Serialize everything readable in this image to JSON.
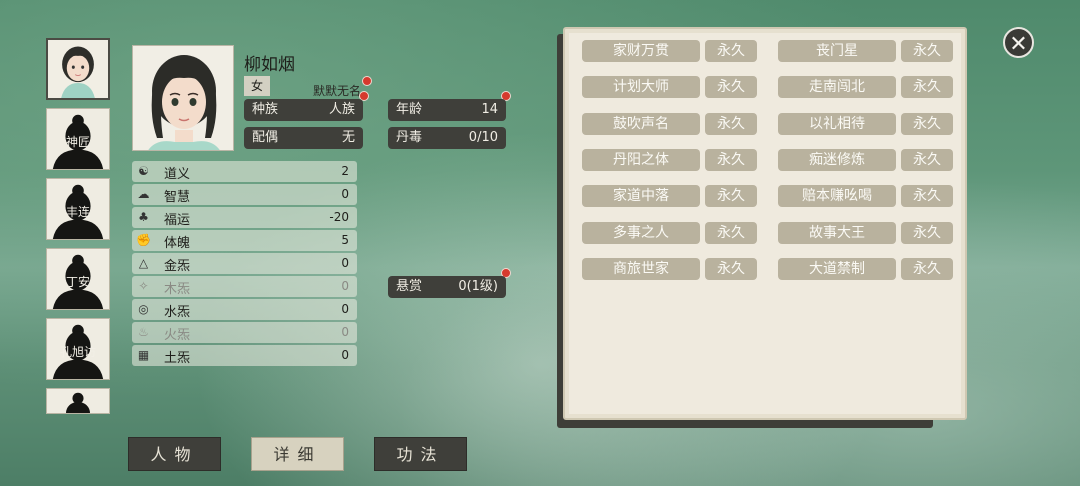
{
  "character": {
    "name": "柳如烟",
    "gender": "女",
    "title": "默默无名",
    "race_label": "种族",
    "race": "人族",
    "spouse_label": "配偶",
    "spouse": "无",
    "age_label": "年龄",
    "age": "14",
    "poison_label": "丹毒",
    "poison": "0/10",
    "bounty_label": "悬赏",
    "bounty": "0(1级)"
  },
  "sidebar": {
    "characters": [
      {
        "name": ""
      },
      {
        "name": "神匠"
      },
      {
        "name": "丰连"
      },
      {
        "name": "丁安"
      },
      {
        "name": "孔旭访"
      },
      {
        "name": ""
      }
    ]
  },
  "stats": [
    {
      "icon": "yin-yang-icon",
      "label": "道义",
      "value": "2",
      "dim": false
    },
    {
      "icon": "brain-icon",
      "label": "智慧",
      "value": "0",
      "dim": false
    },
    {
      "icon": "clover-icon",
      "label": "福运",
      "value": "-20",
      "dim": false
    },
    {
      "icon": "fist-icon",
      "label": "体魄",
      "value": "5",
      "dim": false
    },
    {
      "icon": "metal-icon",
      "label": "金炁",
      "value": "0",
      "dim": false
    },
    {
      "icon": "wood-icon",
      "label": "木炁",
      "value": "0",
      "dim": true
    },
    {
      "icon": "water-icon",
      "label": "水炁",
      "value": "0",
      "dim": false
    },
    {
      "icon": "fire-icon",
      "label": "火炁",
      "value": "0",
      "dim": true
    },
    {
      "icon": "earth-icon",
      "label": "土炁",
      "value": "0",
      "dim": false
    }
  ],
  "traits": [
    {
      "name": "家财万贯",
      "duration": "永久"
    },
    {
      "name": "丧门星",
      "duration": "永久"
    },
    {
      "name": "计划大师",
      "duration": "永久"
    },
    {
      "name": "走南闯北",
      "duration": "永久"
    },
    {
      "name": "鼓吹声名",
      "duration": "永久"
    },
    {
      "name": "以礼相待",
      "duration": "永久"
    },
    {
      "name": "丹阳之体",
      "duration": "永久"
    },
    {
      "name": "痴迷修炼",
      "duration": "永久"
    },
    {
      "name": "家道中落",
      "duration": "永久"
    },
    {
      "name": "赔本赚吆喝",
      "duration": "永久"
    },
    {
      "name": "多事之人",
      "duration": "永久"
    },
    {
      "name": "故事大王",
      "duration": "永久"
    },
    {
      "name": "商旅世家",
      "duration": "永久"
    },
    {
      "name": "大道禁制",
      "duration": "永久"
    }
  ],
  "tabs": [
    {
      "label": "人物",
      "active": false
    },
    {
      "label": "详细",
      "active": true
    },
    {
      "label": "功法",
      "active": false
    }
  ],
  "colors": {
    "accent_dark": "#3f3f3a",
    "trait_tag": "#b9b29e",
    "alert_dot": "#d63a2e",
    "panel_bg": "#efeade"
  }
}
